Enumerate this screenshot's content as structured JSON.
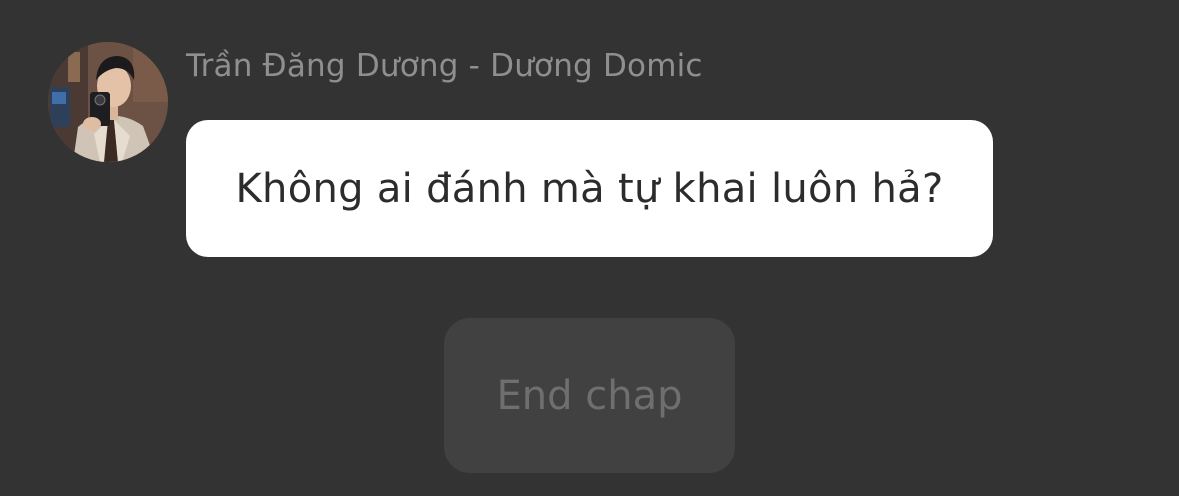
{
  "message": {
    "sender_name": "Trần Đăng Dương - Dương Domic",
    "text": "Không ai đánh mà tự khai luôn hả?",
    "avatar_icon": "profile-photo-selfie"
  },
  "end_button": {
    "label": "End chap"
  },
  "colors": {
    "background": "#333333",
    "bubble": "#ffffff",
    "bubble_text": "#2c2c2c",
    "sender_text": "#8f8f8f",
    "button_bg": "#414141",
    "button_text": "#6f6f6f"
  }
}
